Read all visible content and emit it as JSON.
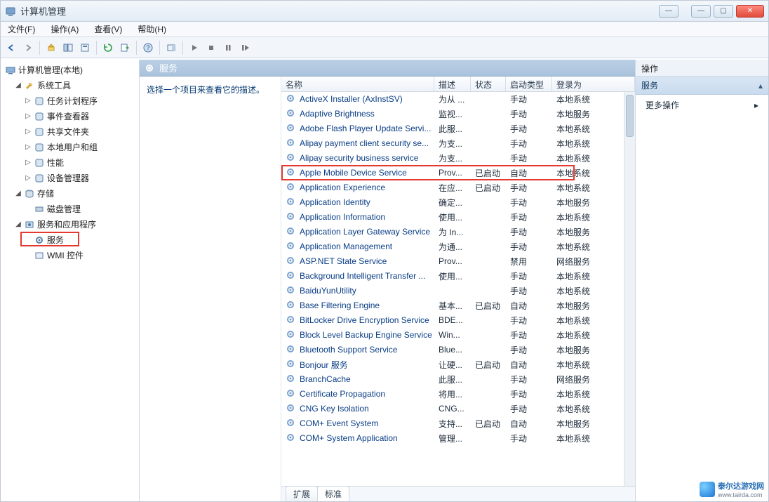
{
  "window": {
    "title": "计算机管理"
  },
  "menus": {
    "file": "文件(F)",
    "action": "操作(A)",
    "view": "查看(V)",
    "help": "帮助(H)"
  },
  "tree": {
    "root": "计算机管理(本地)",
    "systools": {
      "label": "系统工具",
      "items": [
        "任务计划程序",
        "事件查看器",
        "共享文件夹",
        "本地用户和组",
        "性能",
        "设备管理器"
      ]
    },
    "storage": {
      "label": "存储",
      "items": [
        "磁盘管理"
      ]
    },
    "apps": {
      "label": "服务和应用程序",
      "services": "服务",
      "wmi": "WMI 控件"
    }
  },
  "services_header": "服务",
  "desc_prompt": "选择一个项目来查看它的描述。",
  "columns": {
    "name": "名称",
    "desc": "描述",
    "status": "状态",
    "start": "启动类型",
    "logon": "登录为"
  },
  "rows": [
    {
      "name": "ActiveX Installer (AxInstSV)",
      "desc": "为从 ...",
      "status": "",
      "start": "手动",
      "logon": "本地系统"
    },
    {
      "name": "Adaptive Brightness",
      "desc": "监视...",
      "status": "",
      "start": "手动",
      "logon": "本地服务"
    },
    {
      "name": "Adobe Flash Player Update Servi...",
      "desc": "此服...",
      "status": "",
      "start": "手动",
      "logon": "本地系统"
    },
    {
      "name": "Alipay payment client security se...",
      "desc": "为支...",
      "status": "",
      "start": "手动",
      "logon": "本地系统"
    },
    {
      "name": "Alipay security business service",
      "desc": "为支...",
      "status": "",
      "start": "手动",
      "logon": "本地系统"
    },
    {
      "name": "Apple Mobile Device Service",
      "desc": "Prov...",
      "status": "已启动",
      "start": "自动",
      "logon": "本地系统",
      "highlight": true
    },
    {
      "name": "Application Experience",
      "desc": "在应...",
      "status": "已启动",
      "start": "手动",
      "logon": "本地系统"
    },
    {
      "name": "Application Identity",
      "desc": "确定...",
      "status": "",
      "start": "手动",
      "logon": "本地服务"
    },
    {
      "name": "Application Information",
      "desc": "使用...",
      "status": "",
      "start": "手动",
      "logon": "本地系统"
    },
    {
      "name": "Application Layer Gateway Service",
      "desc": "为 In...",
      "status": "",
      "start": "手动",
      "logon": "本地服务"
    },
    {
      "name": "Application Management",
      "desc": "为通...",
      "status": "",
      "start": "手动",
      "logon": "本地系统"
    },
    {
      "name": "ASP.NET State Service",
      "desc": "Prov...",
      "status": "",
      "start": "禁用",
      "logon": "网络服务"
    },
    {
      "name": "Background Intelligent Transfer ...",
      "desc": "使用...",
      "status": "",
      "start": "手动",
      "logon": "本地系统"
    },
    {
      "name": "BaiduYunUtility",
      "desc": "",
      "status": "",
      "start": "手动",
      "logon": "本地系统"
    },
    {
      "name": "Base Filtering Engine",
      "desc": "基本...",
      "status": "已启动",
      "start": "自动",
      "logon": "本地服务"
    },
    {
      "name": "BitLocker Drive Encryption Service",
      "desc": "BDE...",
      "status": "",
      "start": "手动",
      "logon": "本地系统"
    },
    {
      "name": "Block Level Backup Engine Service",
      "desc": "Win...",
      "status": "",
      "start": "手动",
      "logon": "本地系统"
    },
    {
      "name": "Bluetooth Support Service",
      "desc": "Blue...",
      "status": "",
      "start": "手动",
      "logon": "本地服务"
    },
    {
      "name": "Bonjour 服务",
      "desc": "让硬...",
      "status": "已启动",
      "start": "自动",
      "logon": "本地系统"
    },
    {
      "name": "BranchCache",
      "desc": "此服...",
      "status": "",
      "start": "手动",
      "logon": "网络服务"
    },
    {
      "name": "Certificate Propagation",
      "desc": "将用...",
      "status": "",
      "start": "手动",
      "logon": "本地系统"
    },
    {
      "name": "CNG Key Isolation",
      "desc": "CNG...",
      "status": "",
      "start": "手动",
      "logon": "本地系统"
    },
    {
      "name": "COM+ Event System",
      "desc": "支持...",
      "status": "已启动",
      "start": "自动",
      "logon": "本地服务"
    },
    {
      "name": "COM+ System Application",
      "desc": "管理...",
      "status": "",
      "start": "手动",
      "logon": "本地系统"
    }
  ],
  "tabs": {
    "extended": "扩展",
    "standard": "标准"
  },
  "actions": {
    "title": "操作",
    "section": "服务",
    "more": "更多操作"
  },
  "watermark": {
    "name": "泰尔达游戏网",
    "url": "www.tairda.com"
  }
}
